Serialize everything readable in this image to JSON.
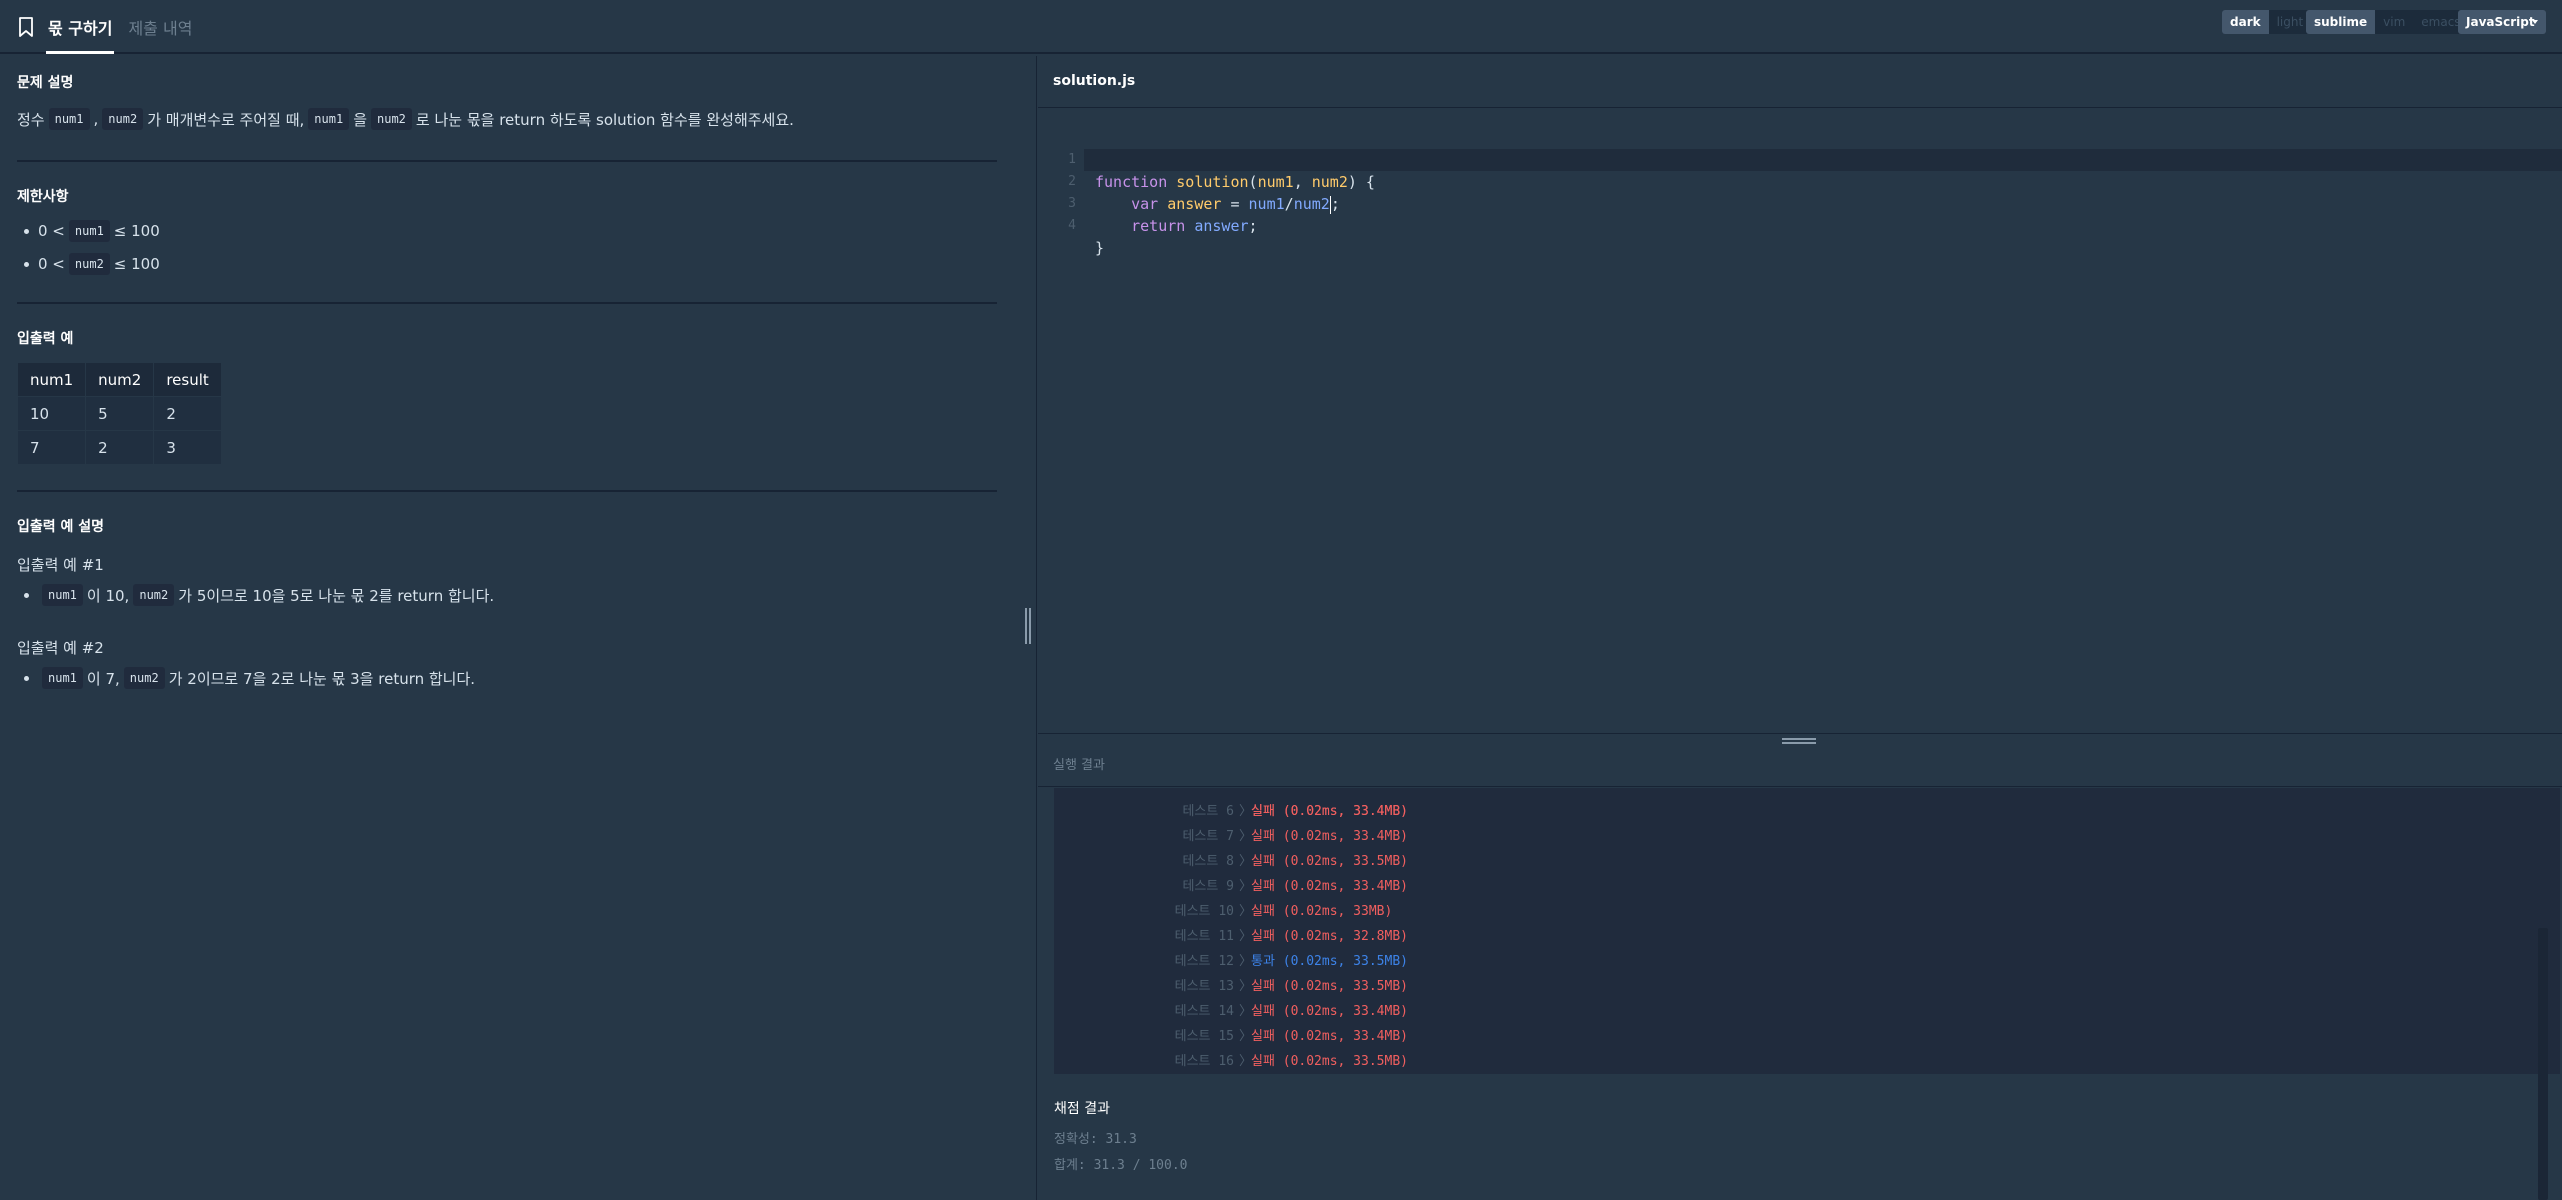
{
  "tabs": {
    "active": "몫 구하기",
    "inactive": "제출 내역"
  },
  "theme_toggle": [
    "dark",
    "light"
  ],
  "keymap_toggle": [
    "sublime",
    "vim",
    "emacs"
  ],
  "language": "JavaScript",
  "problem": {
    "desc_title": "문제 설명",
    "desc": {
      "p1": "정수",
      "c1": "num1",
      "p2": ",",
      "c2": "num2",
      "p3": "가 매개변수로 주어질 때,",
      "c3": "num1",
      "p4": "을",
      "c4": "num2",
      "p5": "로 나눈 몫을 return 하도록 solution 함수를 완성해주세요."
    },
    "limits_title": "제한사항",
    "limits": [
      {
        "pre": "0 <",
        "code": "num1",
        "post": "≤ 100"
      },
      {
        "pre": "0 <",
        "code": "num2",
        "post": "≤ 100"
      }
    ],
    "io_title": "입출력 예",
    "io_table": {
      "headers": [
        "num1",
        "num2",
        "result"
      ],
      "rows": [
        [
          "10",
          "5",
          "2"
        ],
        [
          "7",
          "2",
          "3"
        ]
      ]
    },
    "io_expl_title": "입출력 예 설명",
    "ex1_title": "입출력 예 #1",
    "ex1": {
      "c1": "num1",
      "t1": "이 10,",
      "c2": "num2",
      "t2": "가 5이므로 10을 5로 나눈 몫 2를 return 합니다."
    },
    "ex2_title": "입출력 예 #2",
    "ex2": {
      "c1": "num1",
      "t1": "이 7,",
      "c2": "num2",
      "t2": "가 2이므로 7을 2로 나눈 몫 3을 return 합니다."
    }
  },
  "editor": {
    "filename": "solution.js",
    "line_numbers": [
      "1",
      "2",
      "3",
      "4"
    ],
    "lines": {
      "l1": {
        "kw": "function",
        "fn": "solution",
        "open": "(",
        "a1": "num1",
        "comma": ", ",
        "a2": "num2",
        "close": ") {"
      },
      "l2": {
        "indent": "    ",
        "kw": "var",
        "id": "answer",
        "eq": " = ",
        "v1": "num1",
        "op": "/",
        "v2": "num2",
        "end": ";"
      },
      "l3": {
        "indent": "    ",
        "kw": "return",
        "v": "answer",
        "end": ";"
      },
      "l4": {
        "text": "}"
      }
    }
  },
  "results": {
    "title": "실행 결과",
    "partial_line": "실패 (0.02ms, 33.4MB)",
    "tests": [
      {
        "label": "테스트 6",
        "status": "실패 (0.02ms, 33.4MB)",
        "pass": false
      },
      {
        "label": "테스트 7",
        "status": "실패 (0.02ms, 33.4MB)",
        "pass": false
      },
      {
        "label": "테스트 8",
        "status": "실패 (0.02ms, 33.5MB)",
        "pass": false
      },
      {
        "label": "테스트 9",
        "status": "실패 (0.02ms, 33.4MB)",
        "pass": false
      },
      {
        "label": "테스트 10",
        "status": "실패 (0.02ms, 33MB)",
        "pass": false
      },
      {
        "label": "테스트 11",
        "status": "실패 (0.02ms, 32.8MB)",
        "pass": false
      },
      {
        "label": "테스트 12",
        "status": "통과 (0.02ms, 33.5MB)",
        "pass": true
      },
      {
        "label": "테스트 13",
        "status": "실패 (0.02ms, 33.5MB)",
        "pass": false
      },
      {
        "label": "테스트 14",
        "status": "실패 (0.02ms, 33.4MB)",
        "pass": false
      },
      {
        "label": "테스트 15",
        "status": "실패 (0.02ms, 33.4MB)",
        "pass": false
      },
      {
        "label": "테스트 16",
        "status": "실패 (0.02ms, 33.5MB)",
        "pass": false
      }
    ],
    "grade_title": "채점 결과",
    "accuracy": "정확성: 31.3",
    "total": "합계: 31.3 / 100.0"
  },
  "colors": {
    "background": "#263747",
    "code_bg": "#202b3d",
    "fail": "#f15f5f",
    "pass": "#3d83e8"
  }
}
